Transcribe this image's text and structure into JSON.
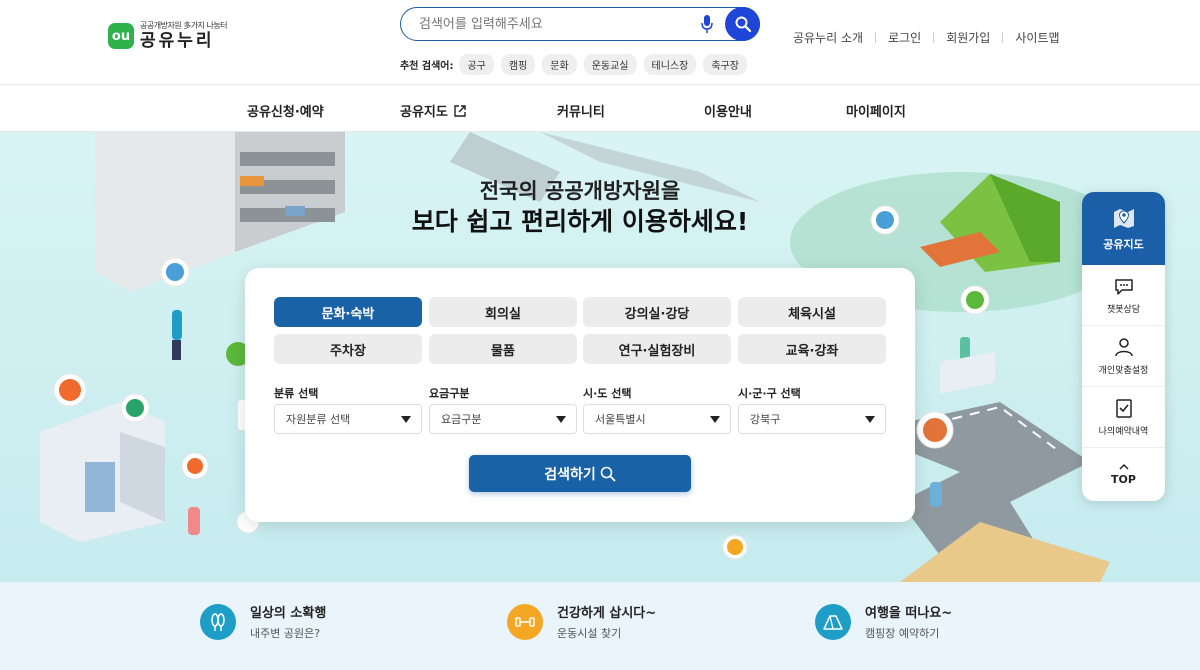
{
  "logo": {
    "mark": "ou",
    "tagline": "공공개방자원 多가지 나눔터",
    "name": "공유누리"
  },
  "search": {
    "placeholder": "검색어를 입력해주세요"
  },
  "recommended": {
    "label": "추천 검색어:",
    "tags": [
      "공구",
      "캠핑",
      "문화",
      "운동교실",
      "테니스장",
      "축구장"
    ]
  },
  "util_links": [
    "공유누리 소개",
    "로그인",
    "회원가입",
    "사이트맵"
  ],
  "nav": [
    "공유신청·예약",
    "공유지도",
    "커뮤니티",
    "이용안내",
    "마이페이지"
  ],
  "hero": {
    "line1": "전국의 공공개방자원을",
    "line2": "보다 쉽고 편리하게 이용하세요!"
  },
  "categories": [
    "문화·숙박",
    "회의실",
    "강의실·강당",
    "체육시설",
    "주차장",
    "물품",
    "연구·실험장비",
    "교육·강좌"
  ],
  "active_category": "문화·숙박",
  "filters": [
    {
      "label": "분류 선택",
      "value": "자원분류 선택"
    },
    {
      "label": "요금구분",
      "value": "요금구분"
    },
    {
      "label": "시·도 선택",
      "value": "서울특별시"
    },
    {
      "label": "시·군·구 선택",
      "value": "강북구"
    }
  ],
  "search_button": "검색하기",
  "quick_menu": {
    "head": "공유지도",
    "items": [
      "챗봇상담",
      "개인맞춤설정",
      "나의예약내역"
    ],
    "top": "TOP"
  },
  "bottom_links": [
    {
      "title": "일상의 소확행",
      "sub": "내주변 공원은?",
      "color": "#1e9ec7",
      "icon": "park-icon"
    },
    {
      "title": "건강하게 삽시다~",
      "sub": "운동시설 찾기",
      "color": "#f5a623",
      "icon": "dumbbell-icon"
    },
    {
      "title": "여행을 떠나요~",
      "sub": "캠핑장 예약하기",
      "color": "#1e9ec7",
      "icon": "tent-icon"
    }
  ],
  "colors": {
    "primary": "#1a62a6",
    "search_button": "#2046d8",
    "logo": "#2fb24b",
    "hero_bg": "#cdeef0"
  }
}
